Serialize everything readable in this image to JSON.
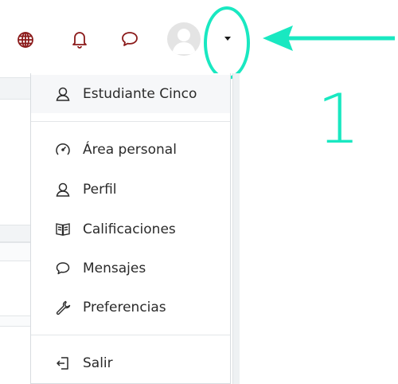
{
  "header": {
    "icons": [
      "globe-icon",
      "bell-icon",
      "chat-bubble-icon"
    ],
    "avatar": "avatar",
    "dropdown_icon": "caret-down-icon",
    "accent_color": "#8b1a1a",
    "highlight_color": "#19e8c1"
  },
  "annotation": {
    "number": "1"
  },
  "menu": {
    "user_name": "Estudiante Cinco",
    "items": [
      {
        "label": "Área personal",
        "icon": "dashboard-gauge-icon"
      },
      {
        "label": "Perfil",
        "icon": "user-icon"
      },
      {
        "label": "Calificaciones",
        "icon": "gradebook-icon"
      },
      {
        "label": "Mensajes",
        "icon": "message-icon"
      },
      {
        "label": "Preferencias",
        "icon": "wrench-icon"
      }
    ],
    "logout": {
      "label": "Salir",
      "icon": "logout-icon"
    }
  }
}
